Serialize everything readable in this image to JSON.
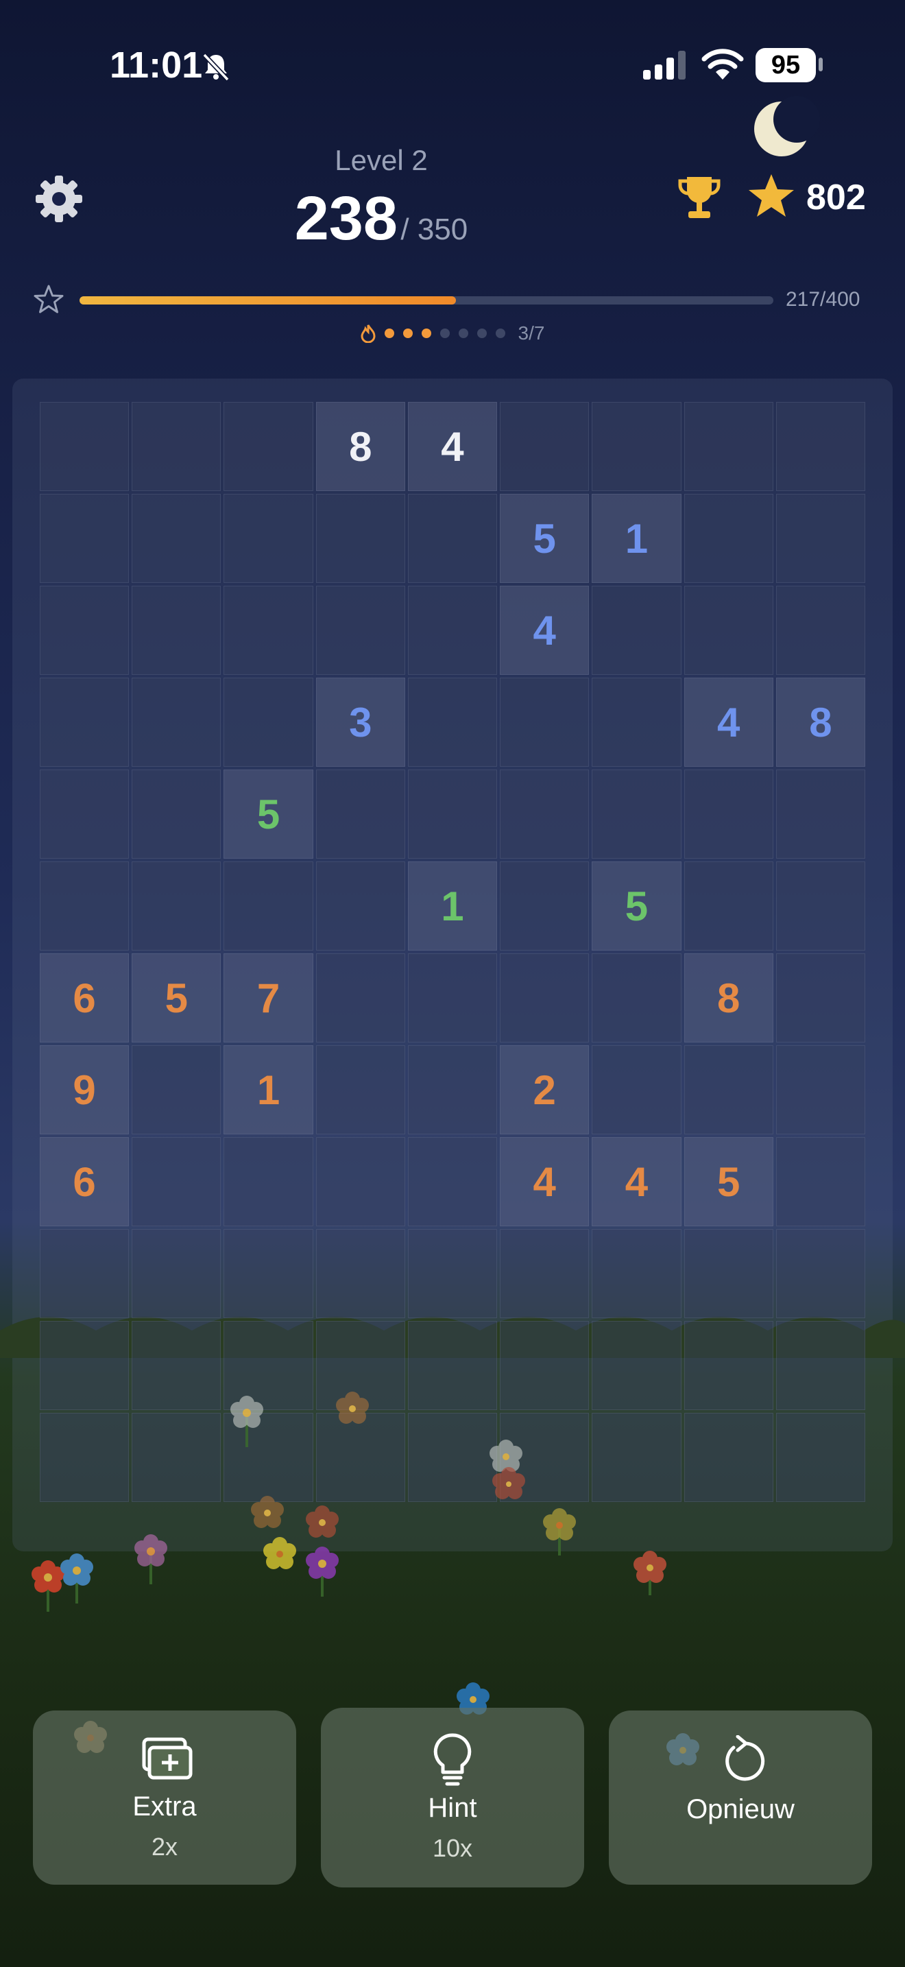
{
  "status": {
    "time": "11:01",
    "battery": "95"
  },
  "header": {
    "level_label": "Level 2",
    "score": "238",
    "score_target": "/ 350",
    "coins": "802"
  },
  "progress": {
    "text": "217/400",
    "fraction": 0.5425
  },
  "streak": {
    "text": "3/7",
    "done": 3,
    "total": 7
  },
  "colors": {
    "white": "#f1f2f6",
    "blue": "#6f93ee",
    "green": "#6cc46a",
    "orange": "#e58a45",
    "accent_gold": "#f2b93b"
  },
  "board": {
    "rows": [
      [
        null,
        null,
        null,
        {
          "v": "8",
          "c": "white"
        },
        {
          "v": "4",
          "c": "white"
        },
        null,
        null,
        null,
        null
      ],
      [
        null,
        null,
        null,
        null,
        null,
        {
          "v": "5",
          "c": "blue"
        },
        {
          "v": "1",
          "c": "blue"
        },
        null,
        null
      ],
      [
        null,
        null,
        null,
        null,
        null,
        {
          "v": "4",
          "c": "blue"
        },
        null,
        null,
        null
      ],
      [
        null,
        null,
        null,
        {
          "v": "3",
          "c": "blue"
        },
        null,
        null,
        null,
        {
          "v": "4",
          "c": "blue"
        },
        {
          "v": "8",
          "c": "blue"
        }
      ],
      [
        null,
        null,
        {
          "v": "5",
          "c": "green"
        },
        null,
        null,
        null,
        null,
        null,
        null
      ],
      [
        null,
        null,
        null,
        null,
        {
          "v": "1",
          "c": "green"
        },
        null,
        {
          "v": "5",
          "c": "green"
        },
        null,
        null
      ],
      [
        {
          "v": "6",
          "c": "orange"
        },
        {
          "v": "5",
          "c": "orange"
        },
        {
          "v": "7",
          "c": "orange"
        },
        null,
        null,
        null,
        null,
        {
          "v": "8",
          "c": "orange"
        },
        null
      ],
      [
        {
          "v": "9",
          "c": "orange"
        },
        null,
        {
          "v": "1",
          "c": "orange"
        },
        null,
        null,
        {
          "v": "2",
          "c": "orange"
        },
        null,
        null,
        null
      ],
      [
        {
          "v": "6",
          "c": "orange"
        },
        null,
        null,
        null,
        null,
        {
          "v": "4",
          "c": "orange"
        },
        {
          "v": "4",
          "c": "orange"
        },
        {
          "v": "5",
          "c": "orange"
        },
        null
      ],
      [
        null,
        null,
        null,
        null,
        null,
        null,
        null,
        null,
        null
      ],
      [
        null,
        null,
        null,
        null,
        null,
        null,
        null,
        null,
        null
      ],
      [
        null,
        null,
        null,
        null,
        null,
        null,
        null,
        null,
        null
      ]
    ]
  },
  "actions": {
    "extra": {
      "label": "Extra",
      "count": "2x",
      "icon": "add-cards-icon"
    },
    "hint": {
      "label": "Hint",
      "count": "10x",
      "icon": "lightbulb-icon"
    },
    "restart": {
      "label": "Opnieuw",
      "icon": "restart-icon"
    }
  }
}
